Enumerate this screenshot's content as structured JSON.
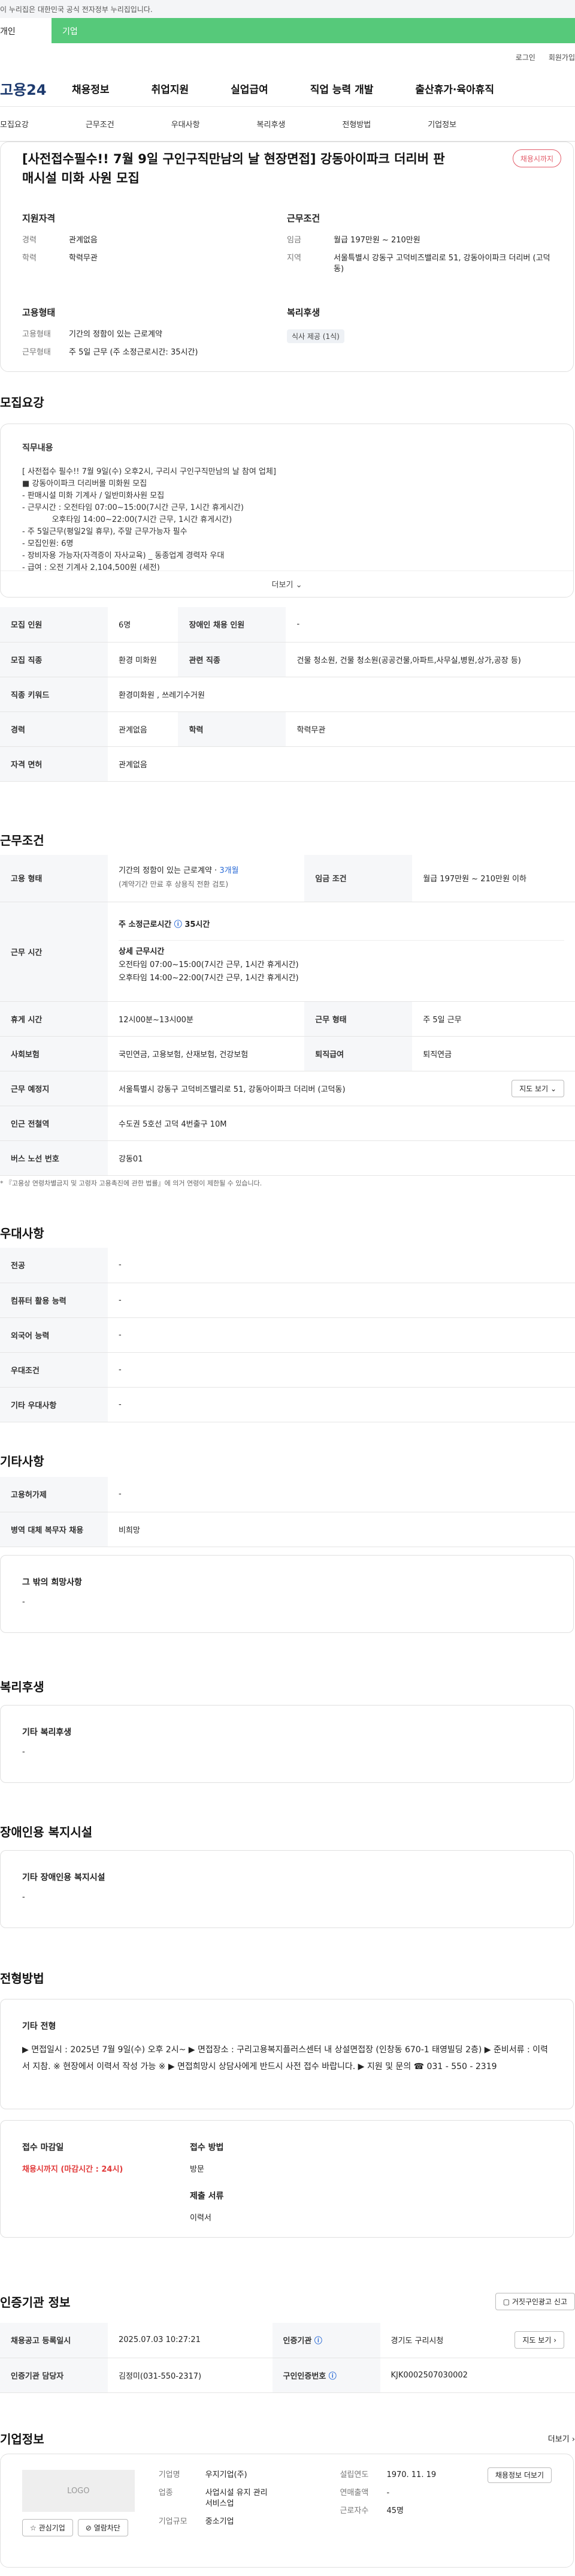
{
  "gov": "이 누리집은 대한민국 공식 전자정부 누리집입니다.",
  "switch": {
    "a": "개인",
    "b": "기업"
  },
  "util": [
    "로그인",
    "회원가입"
  ],
  "logo": "고용24",
  "gnb": [
    "채용정보",
    "취업지원",
    "실업급여",
    "직업 능력 개발",
    "출산휴가·육아휴직"
  ],
  "tabs": [
    "모집요강",
    "근무조건",
    "우대사항",
    "복리후생",
    "전형방법",
    "기업정보"
  ],
  "title": "[사전접수필수!! 7월 9일 구인구직만남의 날 현장면접] 강동아이파크 더리버 판매시설 미화 사원 모집",
  "badge": "채용시까지",
  "summary": {
    "apply_h": "지원자격",
    "exp_k": "경력",
    "exp_v": "관계없음",
    "edu_k": "학력",
    "edu_v": "학력무관",
    "cond_h": "근무조건",
    "pay_k": "임금",
    "pay_v": "월급 197만원 ~ 210만원",
    "loc_k": "지역",
    "loc_v": "서울특별시 강동구 고덕비즈밸리로 51, 강동아이파크 더리버 (고덕동)",
    "type_h": "고용형태",
    "type_k": "고용형태",
    "type_v": "기간의 정함이 있는 근로계약",
    "work_k": "근무형태",
    "work_v": "주 5일 근무 (주 소정근로시간: 35시간)",
    "wel_h": "복리후생",
    "wel_tag": "식사 제공 (1식)"
  },
  "recruit": {
    "h": "모집요강",
    "sub": "직무내용",
    "lines": [
      "[ 사전접수 필수!! 7월 9일(수) 오후2시, 구리시 구인구직만남의 날 참여 업체]",
      "■ 강동아이파크 더리버몰 미화원 모집",
      "- 판매시설 미화 기계사 / 일반미화사원 모집",
      "- 근무시간 : 오전타임 07:00~15:00(7시간 근무, 1시간 휴게시간)",
      "            오후타임 14:00~22:00(7시간 근무, 1시간 휴게시간)",
      "- 주 5일근무(평일2일 휴무), 주말 근무가능자 필수",
      "- 모집인원: 6명",
      "- 장비자용 가능자(자격증이 자사교육) _ 동종업계 경력자 우대",
      "- 급여 : 오전 기계사 2,104,500원 (세전)"
    ],
    "more": "더보기",
    "rows": [
      [
        "모집 인원",
        "6명",
        "장애인 채용 인원",
        "-"
      ],
      [
        "모집 직종",
        "환경 미화원",
        "관련 직종",
        "건물 청소원, 건물 청소원(공공건물,아파트,사무실,병원,상가,공장 등)"
      ],
      [
        "직종 키워드",
        "환경미화원 , 쓰레기수거원",
        "",
        ""
      ],
      [
        "경력",
        "관계없음",
        "학력",
        "학력무관"
      ],
      [
        "자격 면허",
        "관계없음",
        "",
        ""
      ]
    ]
  },
  "work": {
    "h": "근무조건",
    "type_k": "고용 형태",
    "type_v1": "기간의 정함이 있는 근로계약 · ",
    "type_v2": "3개월",
    "type_v3": "(계약기간 만료 후 상용직 전환 검토)",
    "pay_k": "임금 조건",
    "pay_v": "월급 197만원 ~ 210만원 이하",
    "time_k": "근무 시간",
    "time_a": "주 소정근로시간",
    "time_b": "35시간",
    "time_c": "상세 근무시간",
    "time_d": "오전타임 07:00~15:00(7시간 근무, 1시간 휴게시간)",
    "time_e": "오후타임 14:00~22:00(7시간 근무, 1시간 휴게시간)",
    "rest_k": "휴게 시간",
    "rest_v": "12시00분~13시00분",
    "form_k": "근무 형태",
    "form_v": "주 5일 근무",
    "ins_k": "사회보험",
    "ins_v": "국민연금, 고용보험, 산재보험, 건강보험",
    "ret_k": "퇴직급여",
    "ret_v": "퇴직연금",
    "addr_k": "근무 예정지",
    "addr_v": "서울특별시 강동구 고덕비즈밸리로 51, 강동아이파크 더리버 (고덕동)",
    "map": "지도 보기",
    "sub_k": "인근 전철역",
    "sub_v": "수도권 5호선 고덕 4번출구 10M",
    "bus_k": "버스 노선 번호",
    "bus_v": "강동01",
    "note": "* 『고용상 연령차별금지 및 고령자 고용촉진에 관한 법률』에 의거 연령이 제한될 수 있습니다."
  },
  "pref": {
    "h": "우대사항",
    "rows": [
      [
        "전공",
        "-"
      ],
      [
        "컴퓨터 활용 능력",
        "-"
      ],
      [
        "외국어 능력",
        "-"
      ],
      [
        "우대조건",
        "-"
      ],
      [
        "기타 우대사항",
        "-"
      ]
    ]
  },
  "etc": {
    "h": "기타사항",
    "rows": [
      [
        "고용허가제",
        "-"
      ],
      [
        "병역 대체 복무자 채용",
        "비희망"
      ]
    ],
    "box_h": "그 밖의 희망사항",
    "box_v": "-"
  },
  "wel": {
    "h": "복리후생",
    "box_h": "기타 복리후생",
    "box_v": "-"
  },
  "dis": {
    "h": "장애인용 복지시설",
    "box_h": "기타 장애인용 복지시설",
    "box_v": "-"
  },
  "sel": {
    "h": "전형방법",
    "box_h": "기타 전형",
    "box_v": "▶ 면접일시 : 2025년 7월 9일(수) 오후 2시~ ▶ 면접장소 : 구리고용복지플러스센터 내 상설면접장 (인창동 670-1 태영빌딩 2층) ▶ 준비서류 : 이력서 지참. ※ 현장에서 이력서 작성 가능 ※ ▶ 면접희망시 상담사에게 반드시 사전 접수 바랍니다. ▶ 지원 및 문의 ☎ 031 - 550 - 2319",
    "dl_h": "접수 마감일",
    "dl_v": "채용시까지 (마감시간 : 24시)",
    "m_h": "접수 방법",
    "m_v": "방문",
    "doc_h": "제출 서류",
    "doc_v": "이력서"
  },
  "agency": {
    "h": "인증기관 정보",
    "report": "거짓구인광고 신고",
    "r1k": "채용공고 등록일시",
    "r1v": "2025.07.03 10:27:21",
    "r1k2": "인증기관",
    "r1v2": "경기도 구리시청",
    "map": "지도 보기",
    "r2k": "인증기관 담당자",
    "r2v": "김정미(031-550-2317)",
    "r2k2": "구인인증번호",
    "r2v2": "KJK0002507030002"
  },
  "company": {
    "h": "기업정보",
    "more": "더보기",
    "logo": "LOGO",
    "fav": "관심기업",
    "block": "열람차단",
    "n_k": "기업명",
    "n_v": "우지기업(주)",
    "i_k": "업종",
    "i_v": "사업시설 유지 관리 서비스업",
    "s_k": "기업규모",
    "s_v": "중소기업",
    "f_k": "설립연도",
    "f_v": "1970. 11. 19",
    "rev_k": "연매출액",
    "rev_v": "-",
    "emp_k": "근로자수",
    "emp_v": "45명",
    "btn": "채용정보 더보기"
  }
}
